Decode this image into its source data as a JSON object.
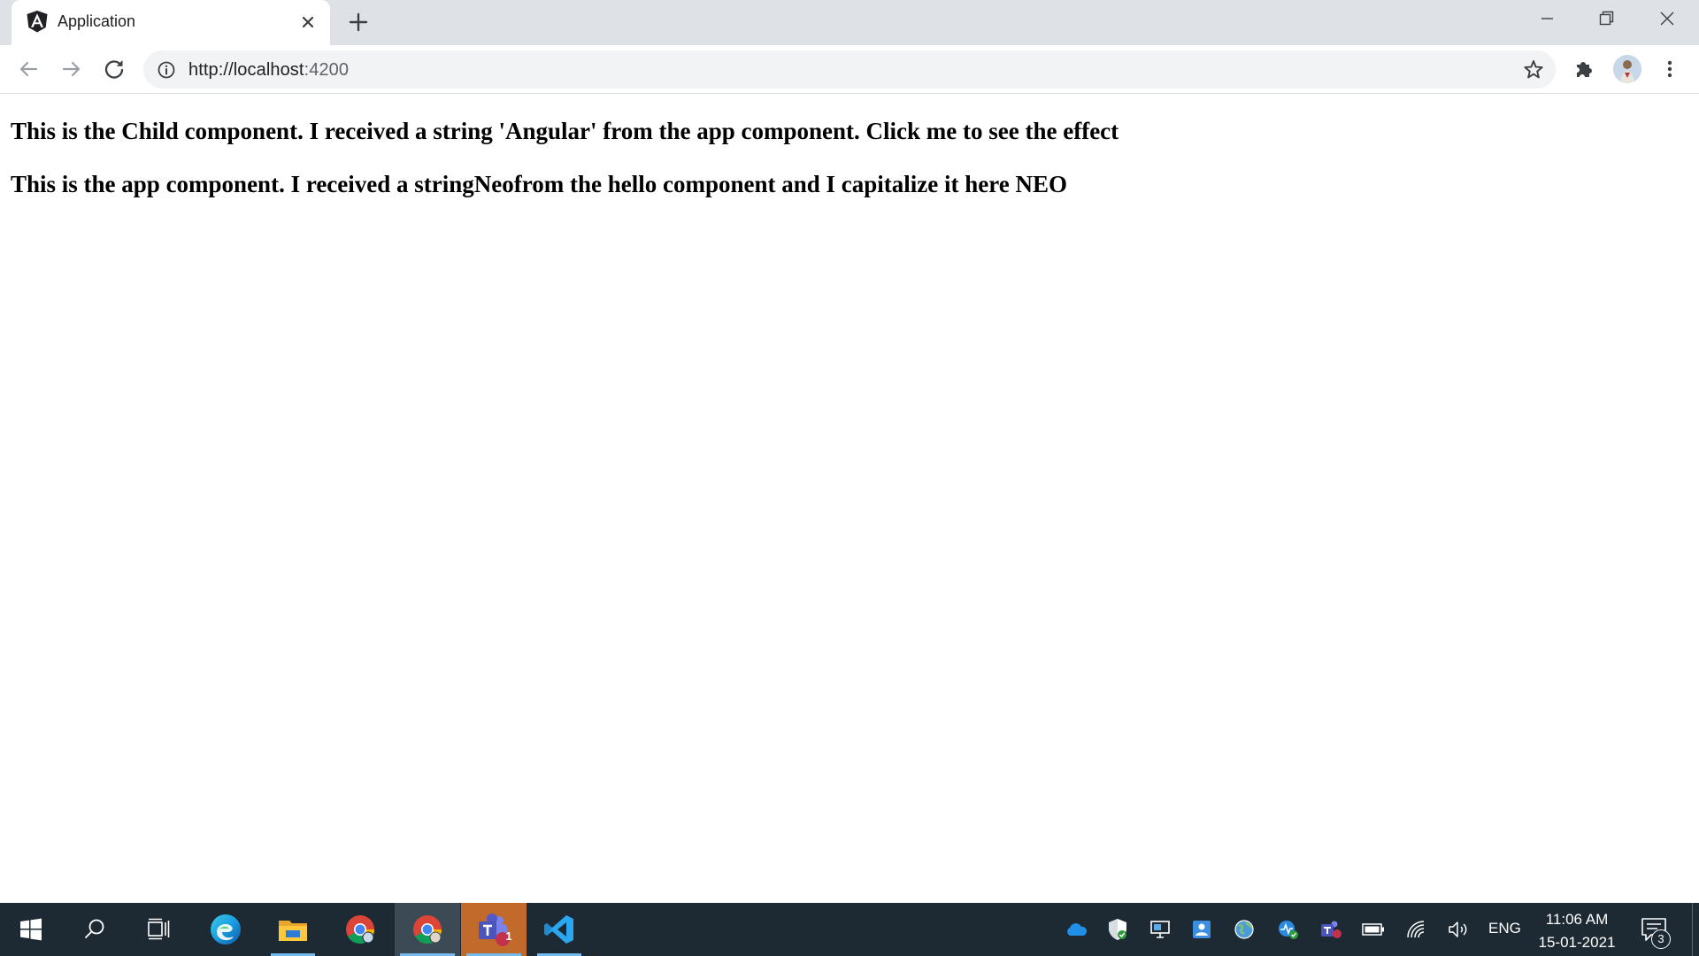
{
  "browser": {
    "tab": {
      "title": "Application",
      "favicon": "angular-logo-icon"
    },
    "url": {
      "protocol_host": "http://localhost",
      "port": ":4200"
    }
  },
  "page": {
    "child_text": "This is the Child component. I received a string 'Angular' from the app component. Click me to see the effect",
    "app_text": "This is the app component. I received a stringNeofrom the hello component and I capitalize it here NEO"
  },
  "taskbar": {
    "apps": [
      "start-icon",
      "search-icon",
      "task-view-icon",
      "edge-icon",
      "file-explorer-icon",
      "chrome-icon",
      "chrome-profile-icon",
      "teams-icon",
      "vscode-icon"
    ],
    "teams_badge": "1",
    "language": "ENG",
    "time": "11:06 AM",
    "date": "15-01-2021",
    "notification_count": "3"
  }
}
